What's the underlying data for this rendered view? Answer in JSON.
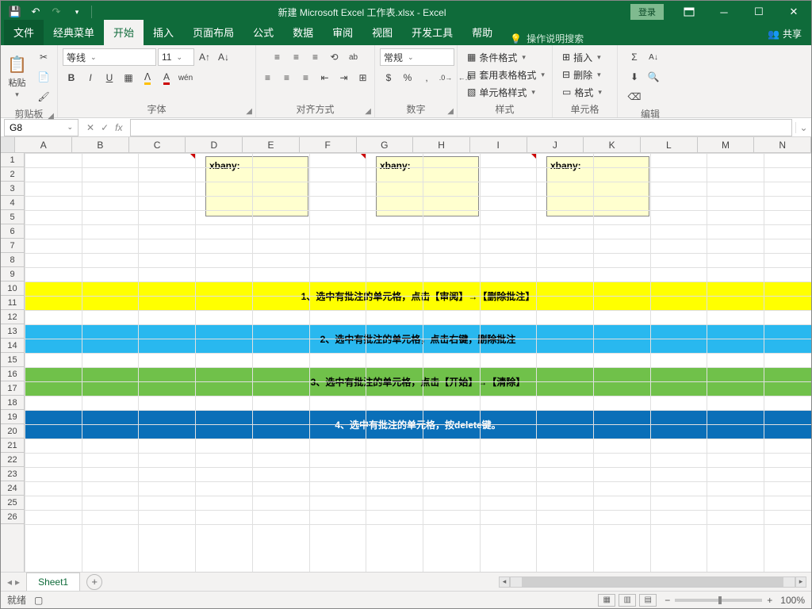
{
  "title": "新建 Microsoft Excel 工作表.xlsx - Excel",
  "login_label": "登录",
  "tabs": {
    "file": "文件",
    "classic": "经典菜单",
    "home": "开始",
    "insert": "插入",
    "layout": "页面布局",
    "formula": "公式",
    "data": "数据",
    "review": "审阅",
    "view": "视图",
    "dev": "开发工具",
    "help": "帮助",
    "tell": "操作说明搜索",
    "share": "共享"
  },
  "ribbon": {
    "clipboard": {
      "label": "剪贴板",
      "paste": "粘贴"
    },
    "font": {
      "label": "字体",
      "name": "等线",
      "size": "11"
    },
    "align": {
      "label": "对齐方式"
    },
    "number": {
      "label": "数字",
      "format": "常规"
    },
    "styles": {
      "label": "样式",
      "cond": "条件格式",
      "tablefmt": "套用表格格式",
      "cellstyle": "单元格样式"
    },
    "cells": {
      "label": "单元格",
      "insert": "插入",
      "delete": "删除",
      "format": "格式"
    },
    "editing": {
      "label": "编辑"
    }
  },
  "namebox": "G8",
  "columns": [
    "A",
    "B",
    "C",
    "D",
    "E",
    "F",
    "G",
    "H",
    "I",
    "J",
    "K",
    "L",
    "M",
    "N"
  ],
  "rows": [
    "1",
    "2",
    "3",
    "4",
    "5",
    "6",
    "7",
    "8",
    "9",
    "10",
    "11",
    "12",
    "13",
    "14",
    "15",
    "16",
    "17",
    "18",
    "19",
    "20",
    "21",
    "22",
    "23",
    "24",
    "25",
    "26"
  ],
  "comments": {
    "c1": "xbany:",
    "c2": "xbany:",
    "c3": "xbany:"
  },
  "bands": {
    "b1": "1、选中有批注的单元格，点击【审阅】→【删除批注】",
    "b2": "2、选中有批注的单元格，点击右键，删除批注",
    "b3": "3、选中有批注的单元格，点击【开始】→【清除】",
    "b4": "4、选中有批注的单元格，按delete键。"
  },
  "sheet_tab": "Sheet1",
  "status": {
    "ready": "就绪",
    "zoom": "100%"
  }
}
